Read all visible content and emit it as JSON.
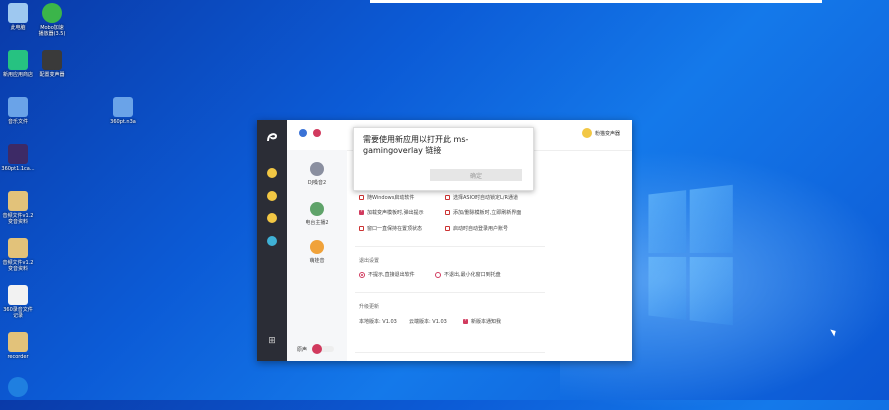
{
  "desktop": {
    "icons": [
      {
        "label": "此电脑",
        "color": "#9ec8f0"
      },
      {
        "label": "Mobo加速\n播放器(3.5)",
        "color": "#3bb54a"
      },
      {
        "label": "新用应用商店",
        "color": "#26c281"
      },
      {
        "label": "配置变声器",
        "color": "#3a3a3a"
      },
      {
        "label": "音乐文件",
        "color": "#6aa3e8"
      },
      {
        "label": "360pt.n3a",
        "color": "#6aa3e8"
      },
      {
        "label": "360pt1.1ca...",
        "color": "#3d2a66"
      },
      {
        "label": "音频文件v1.2\n变音资料",
        "color": "#e2c27a"
      },
      {
        "label": "音频文件v1.2\n变音资料",
        "color": "#e2c27a"
      },
      {
        "label": "360录音文件\n记录",
        "color": "#f2f2f2"
      },
      {
        "label": "recorder",
        "color": "#e2c27a"
      },
      {
        "label": "",
        "color": "#1f7fe0"
      }
    ]
  },
  "app": {
    "user_name": "粉猫变声器",
    "presets": [
      "DJ嗓音2",
      "电台主播2",
      "萌娃音"
    ],
    "checkboxes": [
      {
        "label": "随Windows启动软件",
        "checked": false
      },
      {
        "label": "选择ASIO时自动锁定L/R通道",
        "checked": false
      },
      {
        "label": "加载变声模板时,弹出提示",
        "checked": true
      },
      {
        "label": "添加/删除模板时,立即刷新界面",
        "checked": false
      },
      {
        "label": "窗口一直保持在置顶状态",
        "checked": false
      },
      {
        "label": "启动时自动登录用户账号",
        "checked": false
      }
    ],
    "exit_section": "退出设置",
    "exit_options": [
      {
        "label": "不提示,直接退出软件",
        "selected": true
      },
      {
        "label": "不退出,最小化窗口到托盘",
        "selected": false
      }
    ],
    "update_section": "升级更新",
    "local_version": "本地版本: V1.03",
    "cloud_version": "云端版本: V1.03",
    "notify_label": "新版本通知我",
    "notify_checked": true,
    "footer_label": "原声",
    "accent": "#d13a5e"
  },
  "dialog": {
    "title": "需要使用新应用以打开此 ms-gamingoverlay 链接",
    "ok_label": "确定"
  }
}
